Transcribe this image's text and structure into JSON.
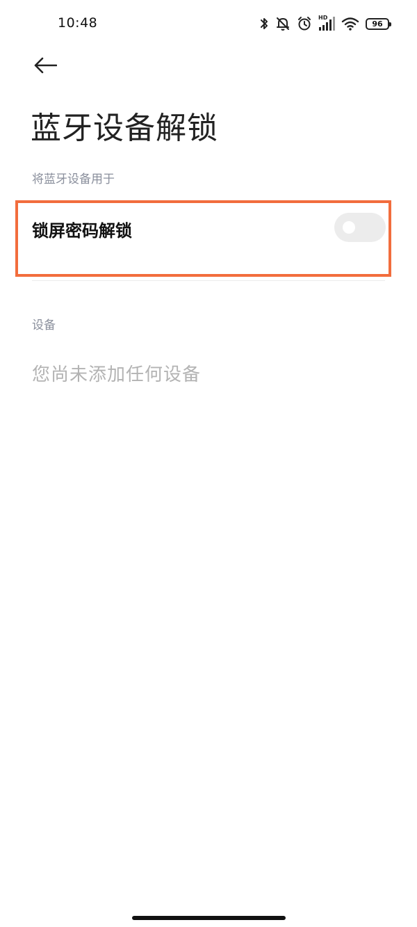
{
  "status_bar": {
    "time": "10:48",
    "battery": "96",
    "network_label": "HD",
    "icons": [
      "bluetooth-icon",
      "mute-bell-icon",
      "alarm-icon",
      "hd-signal-icon",
      "wifi-icon",
      "battery-icon"
    ]
  },
  "header": {
    "back_icon": "arrow-left-icon",
    "title": "蓝牙设备解锁"
  },
  "usage_section": {
    "label": "将蓝牙设备用于",
    "toggle": {
      "label": "锁屏密码解锁",
      "enabled": false
    },
    "highlight_color": "#f26d3d"
  },
  "devices_section": {
    "label": "设备",
    "empty_message": "您尚未添加任何设备"
  }
}
